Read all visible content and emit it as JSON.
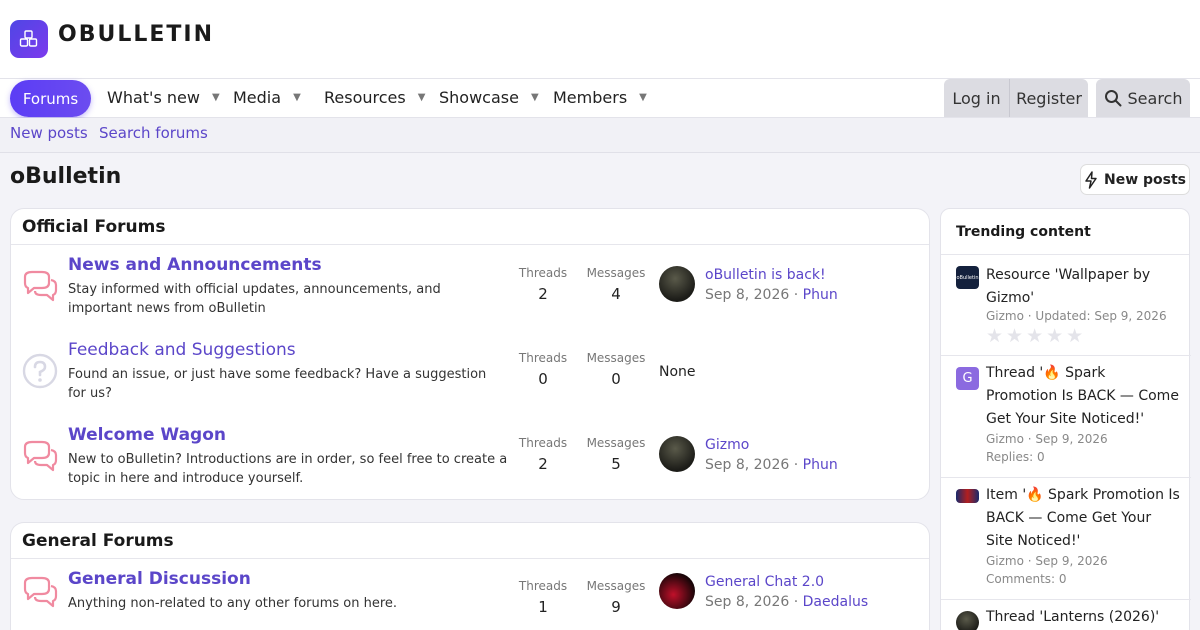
{
  "brand": {
    "name": "OBULLETIN"
  },
  "nav": {
    "forums": "Forums",
    "tabs": [
      "What's new",
      "Media",
      "Resources",
      "Showcase",
      "Members"
    ],
    "login": "Log in",
    "register": "Register",
    "search": "Search"
  },
  "subnav": {
    "new_posts": "New posts",
    "search_forums": "Search forums"
  },
  "page": {
    "title": "oBulletin",
    "new_posts_button": "New posts"
  },
  "labels": {
    "threads": "Threads",
    "messages": "Messages"
  },
  "official": {
    "heading": "Official Forums",
    "nodes": [
      {
        "title": "News and Announcements",
        "desc": "Stay informed with official updates, announcements, and important news from oBulletin",
        "threads": "2",
        "messages": "4",
        "last_title": "oBulletin is back!",
        "last_date": "Sep 8, 2026 ·",
        "last_user": "Phun"
      },
      {
        "title": "Feedback and Suggestions",
        "desc": "Found an issue, or just have some feedback? Have a suggestion for us?",
        "threads": "0",
        "messages": "0",
        "none": "None"
      },
      {
        "title": "Welcome Wagon",
        "desc": "New to oBulletin? Introductions are in order, so feel free to create a topic in here and introduce yourself.",
        "threads": "2",
        "messages": "5",
        "last_title": "Gizmo",
        "last_date": "Sep 8, 2026 ·",
        "last_user": "Phun"
      }
    ]
  },
  "general": {
    "heading": "General Forums",
    "nodes": [
      {
        "title": "General Discussion",
        "desc": "Anything non-related to any other forums on here.",
        "threads": "1",
        "messages": "9",
        "last_title": "General Chat 2.0",
        "last_date": "Sep 8, 2026 ·",
        "last_user": "Daedalus"
      }
    ]
  },
  "trending": {
    "heading": "Trending content",
    "items": [
      {
        "title": "Resource 'Wallpaper by Gizmo'",
        "meta": "Gizmo · Updated: Sep 9, 2026",
        "thumb_text": "oBulletin",
        "rating_stars": 0
      },
      {
        "title": "Thread '🔥 Spark Promotion Is BACK — Come Get Your Site Noticed!'",
        "meta": "Gizmo · Sep 9, 2026",
        "extra": "Replies: 0",
        "thumb_text": "G"
      },
      {
        "title": "Item '🔥 Spark Promotion Is BACK — Come Get Your Site Noticed!'",
        "meta": "Gizmo · Sep 9, 2026",
        "extra": "Comments: 0"
      },
      {
        "title": "Thread 'Lanterns (2026)'"
      }
    ]
  },
  "colors": {
    "accent": "#5b46c9",
    "brand_gradient_start": "#4f46e5",
    "brand_gradient_end": "#7c3aed"
  }
}
